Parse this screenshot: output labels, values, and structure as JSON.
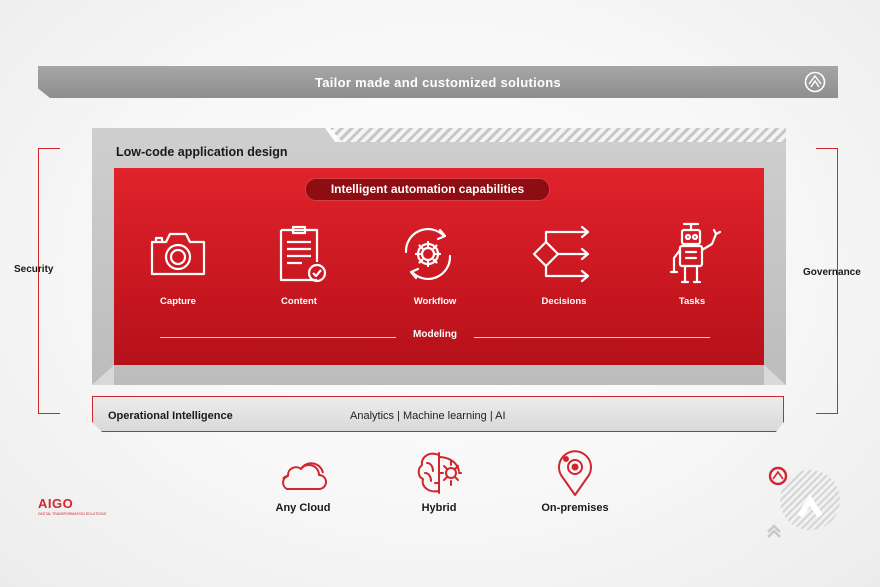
{
  "banner": {
    "title": "Tailor made and customized solutions"
  },
  "frame": {
    "title": "Low-code application design"
  },
  "automation": {
    "title": "Intelligent automation capabilities",
    "capabilities": [
      {
        "label": "Capture",
        "icon": "camera-icon"
      },
      {
        "label": "Content",
        "icon": "document-check-icon"
      },
      {
        "label": "Workflow",
        "icon": "gear-cycle-icon"
      },
      {
        "label": "Decisions",
        "icon": "decision-diamond-icon"
      },
      {
        "label": "Tasks",
        "icon": "robot-icon"
      }
    ],
    "modeling": "Modeling"
  },
  "operational": {
    "title": "Operational Intelligence",
    "subtitle": "Analytics | Machine learning | AI"
  },
  "sides": {
    "left": "Security",
    "right": "Governance"
  },
  "deployment": [
    {
      "label": "Any Cloud",
      "icon": "cloud-icon"
    },
    {
      "label": "Hybrid",
      "icon": "brain-gear-icon"
    },
    {
      "label": "On-premises",
      "icon": "location-pin-icon"
    }
  ],
  "brand": {
    "name": "AIGO",
    "tagline": "DIGITAL TRANSFORMATION SOLUTIONS",
    "accent": "#d1262d"
  }
}
